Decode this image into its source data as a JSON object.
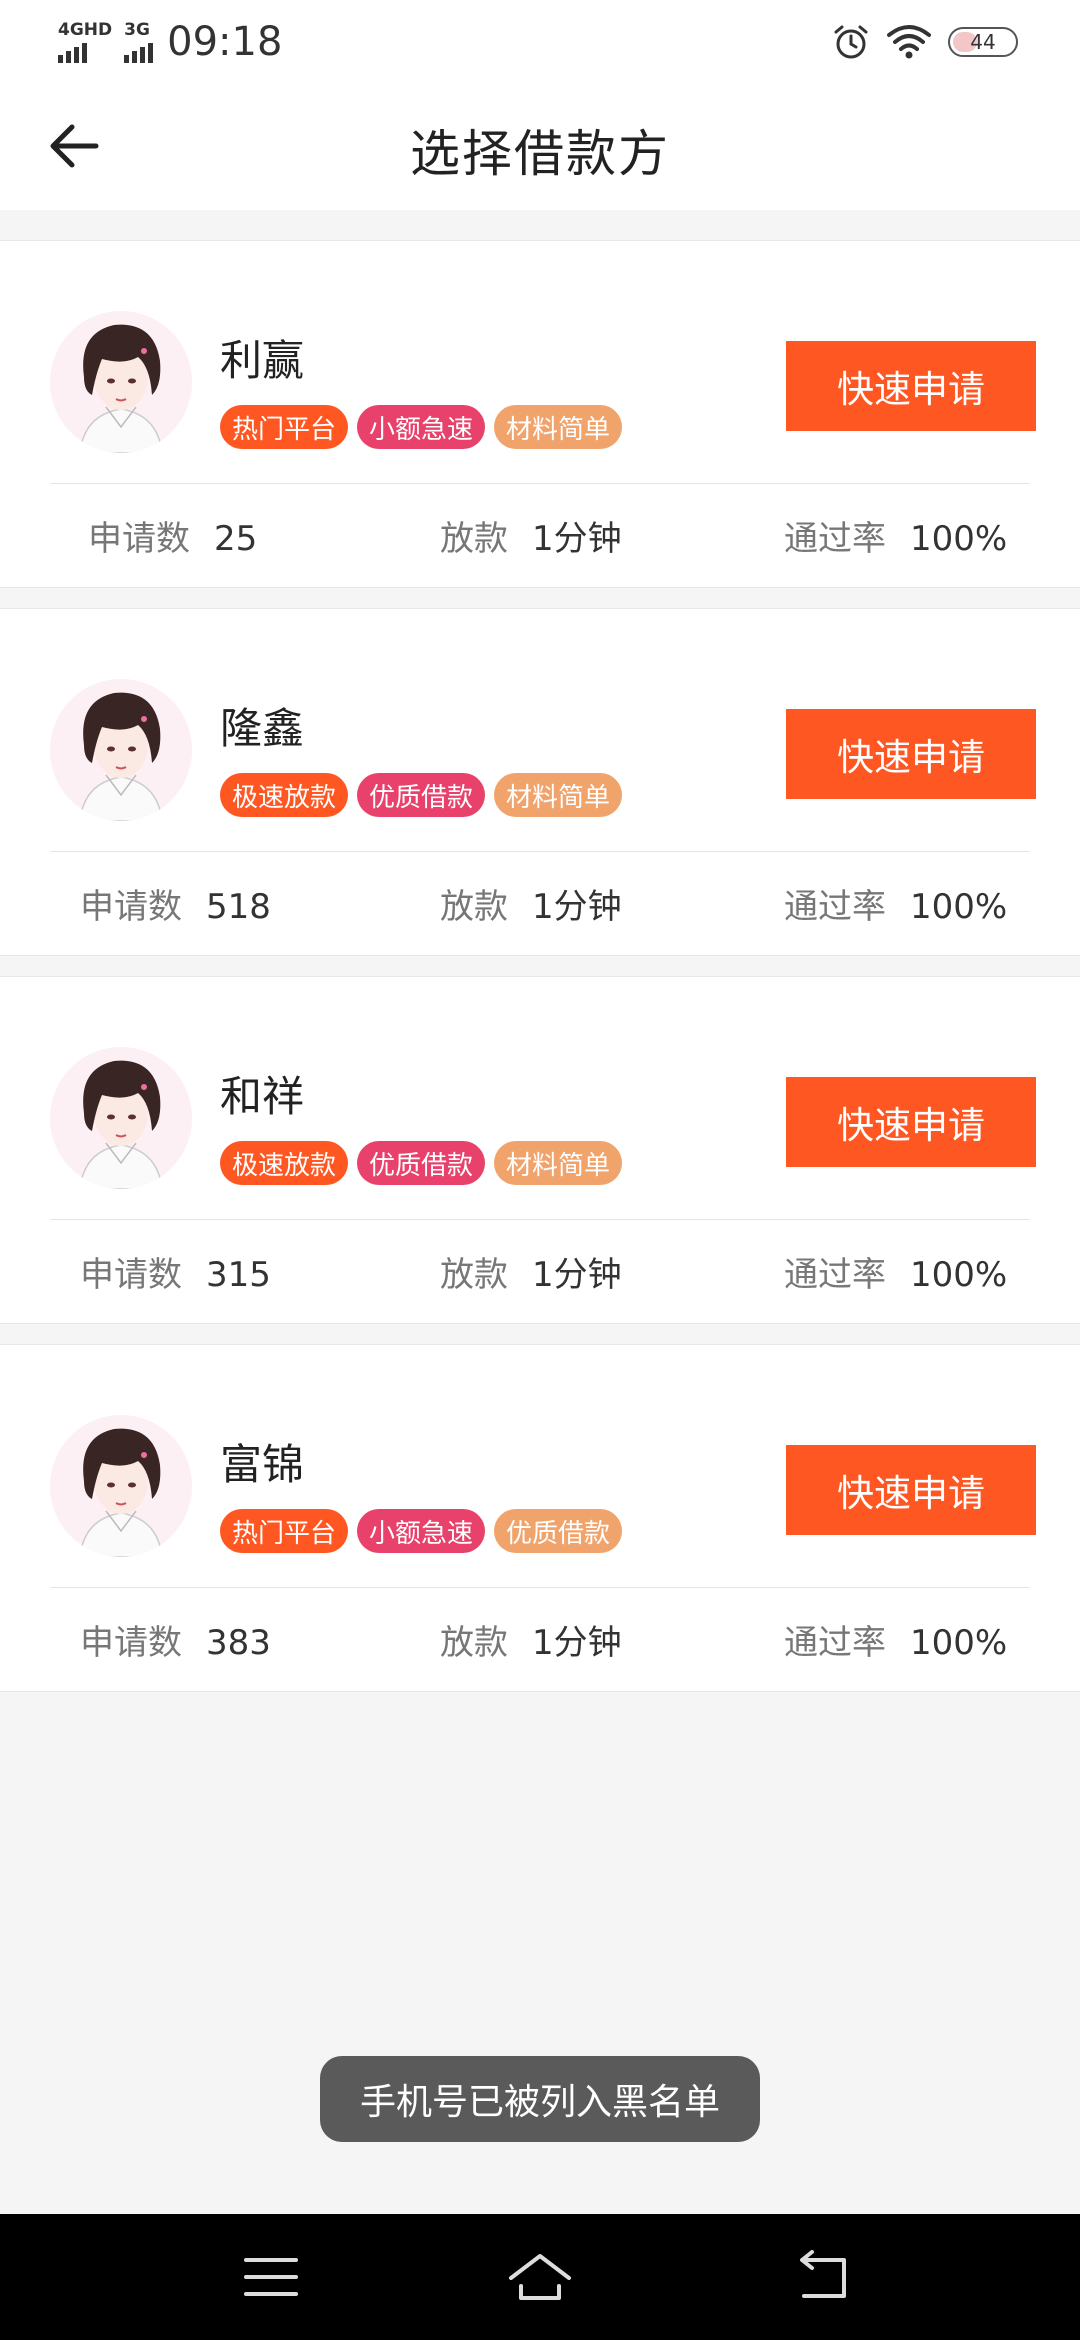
{
  "status_bar": {
    "signal1_label": "4GHD",
    "signal2_label": "3G",
    "time": "09:18",
    "battery": "44",
    "icons": [
      "alarm-icon",
      "wifi-icon",
      "battery-icon"
    ]
  },
  "header": {
    "title": "选择借款方",
    "back_icon": "arrow-left-icon"
  },
  "colors": {
    "accent": "#ff5722",
    "tag_hot": "#ff5722",
    "tag_pink": "#e8416b",
    "tag_peach": "#f0a36b"
  },
  "labels": {
    "applications": "申请数",
    "loan": "放款",
    "pass_rate": "通过率",
    "apply_button": "快速申请"
  },
  "lenders": [
    {
      "name": "利赢",
      "tags": [
        {
          "text": "热门平台",
          "color": "#ff5722"
        },
        {
          "text": "小额急速",
          "color": "#e8416b"
        },
        {
          "text": "材料简单",
          "color": "#f0a36b"
        }
      ],
      "applications": "25",
      "loan_time": "1分钟",
      "pass_rate": "100%"
    },
    {
      "name": "隆鑫",
      "tags": [
        {
          "text": "极速放款",
          "color": "#ff5722"
        },
        {
          "text": "优质借款",
          "color": "#e8416b"
        },
        {
          "text": "材料简单",
          "color": "#f0a36b"
        }
      ],
      "applications": "518",
      "loan_time": "1分钟",
      "pass_rate": "100%"
    },
    {
      "name": "和祥",
      "tags": [
        {
          "text": "极速放款",
          "color": "#ff5722"
        },
        {
          "text": "优质借款",
          "color": "#e8416b"
        },
        {
          "text": "材料简单",
          "color": "#f0a36b"
        }
      ],
      "applications": "315",
      "loan_time": "1分钟",
      "pass_rate": "100%"
    },
    {
      "name": "富锦",
      "tags": [
        {
          "text": "热门平台",
          "color": "#ff5722"
        },
        {
          "text": "小额急速",
          "color": "#e8416b"
        },
        {
          "text": "优质借款",
          "color": "#f0a36b"
        }
      ],
      "applications": "383",
      "loan_time": "1分钟",
      "pass_rate": "100%"
    }
  ],
  "toast": "手机号已被列入黑名单",
  "nav": [
    "menu-icon",
    "home-icon",
    "back-icon"
  ]
}
